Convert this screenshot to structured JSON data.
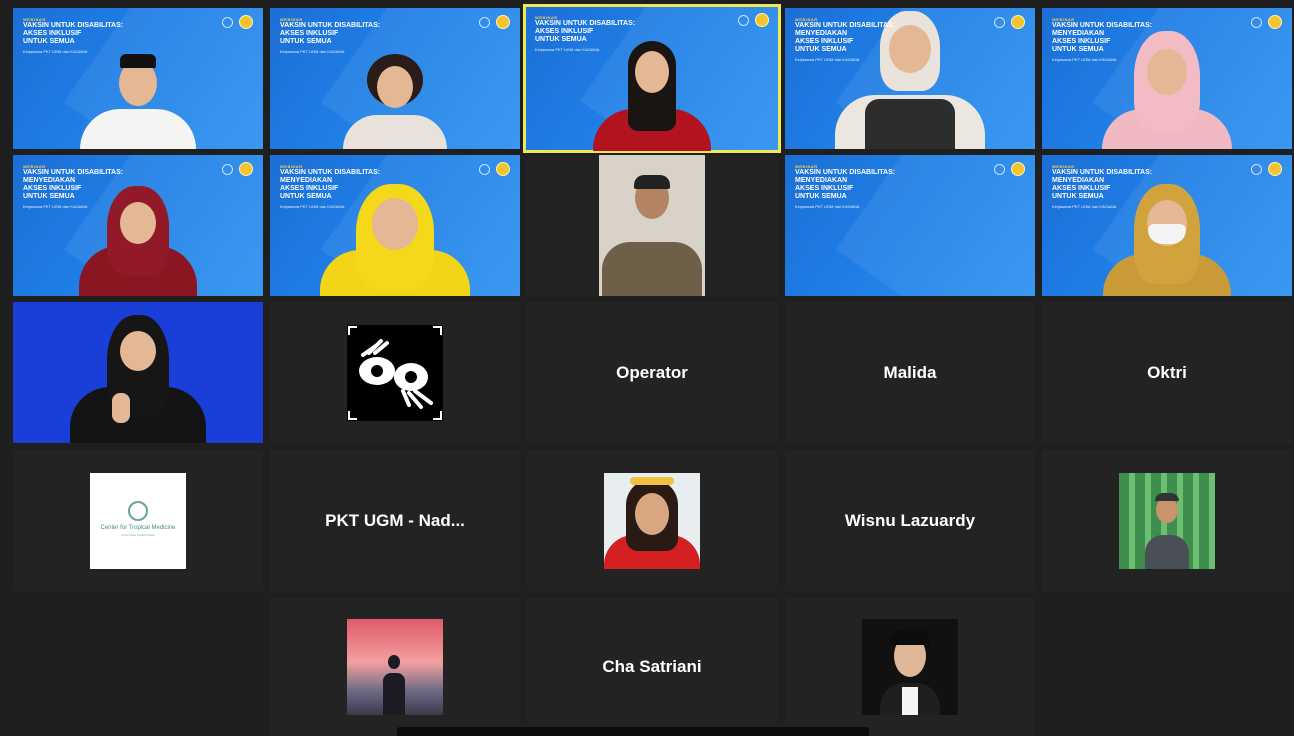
{
  "webinar": {
    "kicker": "WEBINAR",
    "title_lines": [
      "VAKSIN UNTUK DISABILITAS:",
      "MENYEDIAKAN",
      "AKSES INKLUSIF",
      "UNTUK SEMUA"
    ],
    "subtitle": "Kerjasama PKT UGM dan KAGAMA"
  },
  "participants": {
    "operator": "Operator",
    "malida": "Malida",
    "oktri": "Oktri",
    "pkt": "PKT UGM - Nad...",
    "wisnu": "Wisnu Lazuardy",
    "cha": "Cha Satriani"
  },
  "ctm": {
    "line1": "Center for Tropical Medicine",
    "line2": "Universitas Gadjah Mada"
  },
  "colors": {
    "active_speaker_border": "#f1e84e",
    "background": "#1f1f1f",
    "tile": "#232323",
    "banner_blue": "#1f7fe6"
  },
  "icons": {
    "sign_language": "sign-language-icon",
    "ctm_logo": "ctm-logo-icon"
  }
}
